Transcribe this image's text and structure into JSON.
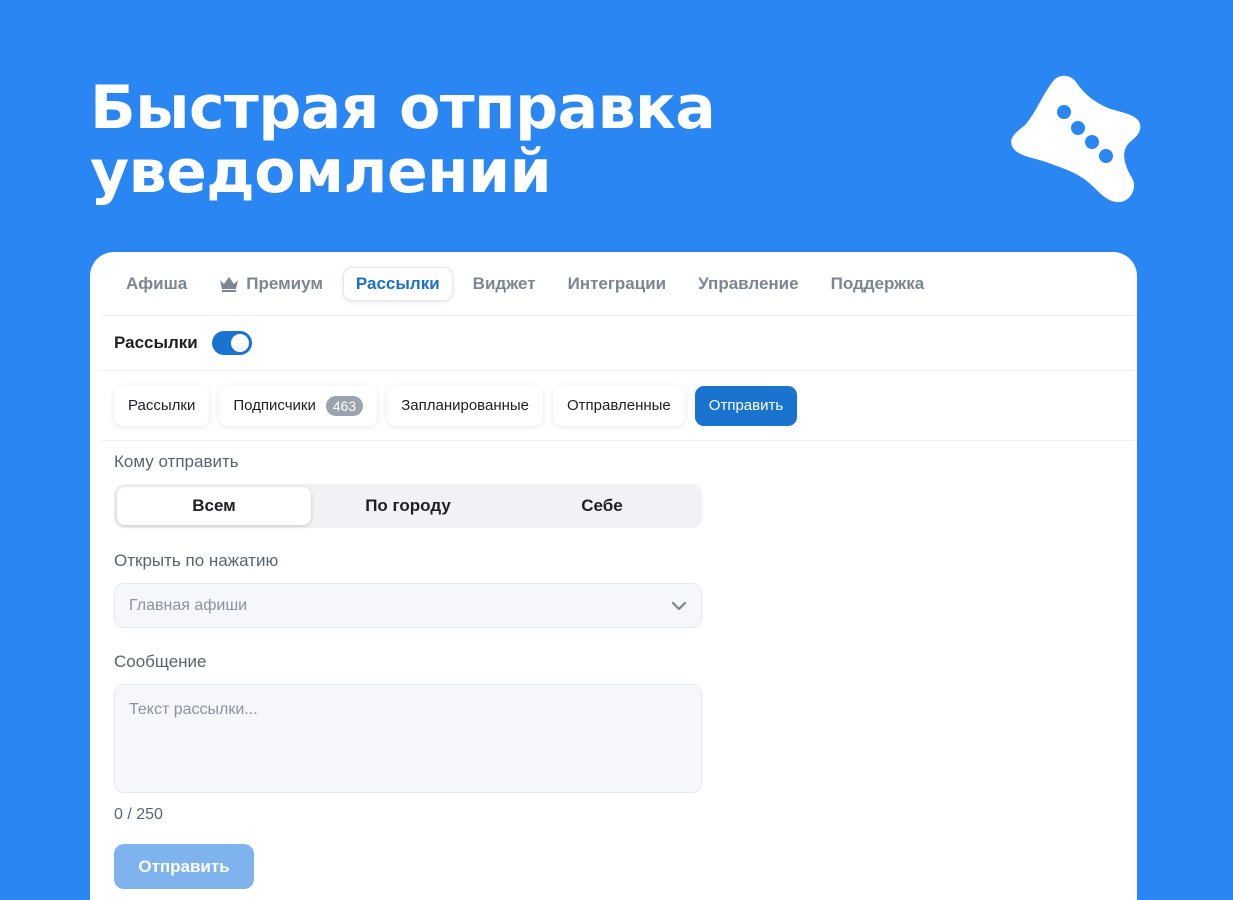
{
  "hero": {
    "title_line1": "Быстрая отправка",
    "title_line2": "уведомлений"
  },
  "colors": {
    "background": "#2a86f3",
    "accent": "#1a73cf",
    "send_disabled": "#7eb3ee"
  },
  "nav": {
    "items": [
      {
        "label": "Афиша"
      },
      {
        "label": "Премиум",
        "icon": "crown-icon"
      },
      {
        "label": "Рассылки",
        "active": true
      },
      {
        "label": "Виджет"
      },
      {
        "label": "Интеграции"
      },
      {
        "label": "Управление"
      },
      {
        "label": "Поддержка"
      }
    ]
  },
  "toggle": {
    "label": "Рассылки",
    "on": true
  },
  "subtabs": {
    "items": [
      {
        "label": "Рассылки"
      },
      {
        "label": "Подписчики",
        "badge": "463"
      },
      {
        "label": "Запланированные"
      },
      {
        "label": "Отправленные"
      },
      {
        "label": "Отправить",
        "primary": true
      }
    ]
  },
  "form": {
    "recipient_label": "Кому отправить",
    "recipient_options": [
      "Всем",
      "По городу",
      "Себе"
    ],
    "recipient_selected": "Всем",
    "open_label": "Открыть по нажатию",
    "open_value": "Главная афиши",
    "message_label": "Сообщение",
    "message_placeholder": "Текст рассылки...",
    "message_value": "",
    "counter": "0 / 250",
    "send_label": "Отправить"
  }
}
